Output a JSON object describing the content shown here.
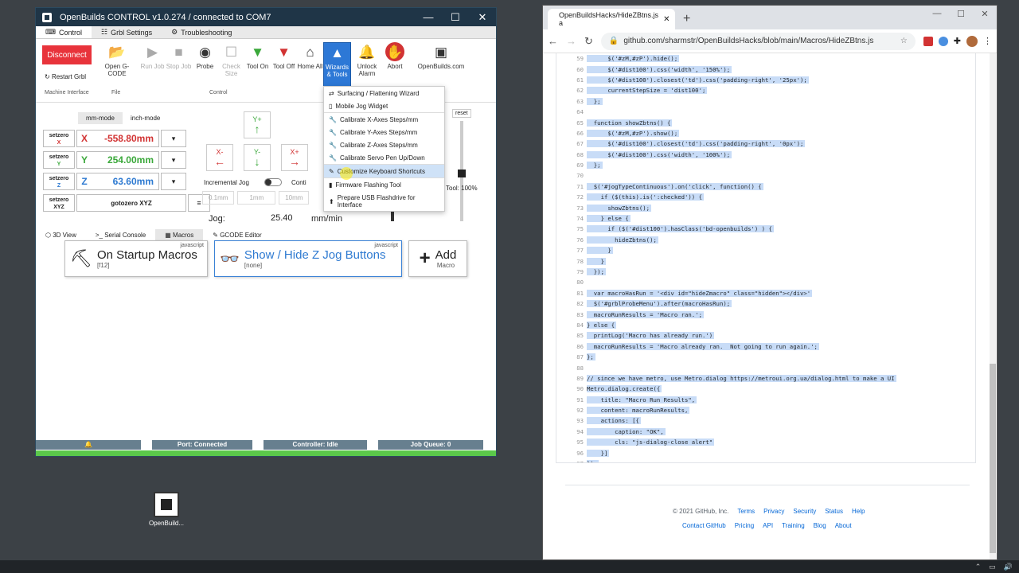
{
  "openbuilds": {
    "title": "OpenBuilds CONTROL v1.0.274 / connected to COM7",
    "window_controls": [
      "—",
      "☐",
      "✕"
    ],
    "tabs": [
      "Control",
      "Grbl Settings",
      "Troubleshooting"
    ],
    "ribbon": {
      "disconnect": "Disconnect",
      "restart": "Restart Grbl",
      "open_label": "Open G-CODE",
      "run": "Run Job",
      "stop": "Stop Job",
      "probe": "Probe",
      "check_size": "Check Size",
      "tool_on": "Tool On",
      "tool_off": "Tool Off",
      "home_all": "Home All",
      "wizards": "Wizards & Tools",
      "unlock": "Unlock Alarm",
      "abort": "Abort",
      "openbuilds_com": "OpenBuilds.com",
      "group_machine": "Machine Interface",
      "group_file": "File",
      "group_control": "Control"
    },
    "wizard_menu": [
      "Surfacing / Flattening Wizard",
      "Mobile Jog Widget",
      "Calibrate X-Axes Steps/mm",
      "Calibrate Y-Axes Steps/mm",
      "Calibrate Z-Axes Steps/mm",
      "Calibrate Servo Pen Up/Down",
      "Customize Keyboard Shortcuts",
      "Firmware Flashing Tool",
      "Prepare USB Flashdrive for Interface"
    ],
    "modes": [
      "mm-mode",
      "inch-mode"
    ],
    "dro": [
      {
        "zero": "setzero",
        "axis": "X",
        "value": "-558.80mm",
        "color": "#d23333"
      },
      {
        "zero": "setzero",
        "axis": "Y",
        "value": "254.00mm",
        "color": "#3aa83a"
      },
      {
        "zero": "setzero",
        "axis": "Z",
        "value": "63.60mm",
        "color": "#2e7ad1"
      }
    ],
    "setzero_xyz": "setzero XYZ",
    "gotozero_xyz": "gotozero XYZ",
    "jog": {
      "y_plus": "Y+",
      "y_minus": "Y-",
      "x_minus": "X-",
      "x_plus": "X+",
      "incremental": "Incremental Jog",
      "continuous": "Conti",
      "steps": [
        "0.1mm",
        "1mm",
        "10mm"
      ],
      "feed_label": "Jog:",
      "feed_value": "25.40",
      "feed_unit": "mm/min",
      "reset": "reset",
      "tool_pct": "Tool: 100%"
    },
    "lower_tabs": [
      "3D View",
      "Serial Console",
      "Macros",
      "GCODE Editor"
    ],
    "macros": [
      {
        "title": "On Startup Macros",
        "lang": "javascript",
        "key": "[f12]"
      },
      {
        "title": "Show / Hide Z Jog Buttons",
        "lang": "javascript",
        "key": "[none]"
      }
    ],
    "add_macro": "Add",
    "add_macro_sub": "Macro",
    "status": {
      "port": "Port: Connected",
      "controller": "Controller: Idle",
      "queue": "Job Queue: 0"
    }
  },
  "desktop_icon": "OpenBuild...",
  "chrome": {
    "tab_title": "OpenBuildsHacks/HideZBtns.js a",
    "url": "github.com/sharmstr/OpenBuildsHacks/blob/main/Macros/HideZBtns.js",
    "code": [
      {
        "n": "59",
        "t": "      $('#zM,#zP').hide();"
      },
      {
        "n": "60",
        "t": "      $('#dist100').css('width', '150%');"
      },
      {
        "n": "61",
        "t": "      $('#dist100').closest('td').css('padding-right', '25px');"
      },
      {
        "n": "62",
        "t": "      currentStepSize = 'dist100';"
      },
      {
        "n": "63",
        "t": "  };"
      },
      {
        "n": "64",
        "t": ""
      },
      {
        "n": "65",
        "t": "  function showZbtns() {"
      },
      {
        "n": "66",
        "t": "      $('#zM,#zP').show();"
      },
      {
        "n": "67",
        "t": "      $('#dist100').closest('td').css('padding-right', '0px');"
      },
      {
        "n": "68",
        "t": "      $('#dist100').css('width', '100%');"
      },
      {
        "n": "69",
        "t": "  };"
      },
      {
        "n": "70",
        "t": ""
      },
      {
        "n": "71",
        "t": "  $('#jogTypeContinuous').on('click', function() {"
      },
      {
        "n": "72",
        "t": "    if ($(this).is(':checked')) {"
      },
      {
        "n": "73",
        "t": "      showZbtns();"
      },
      {
        "n": "74",
        "t": "    } else {"
      },
      {
        "n": "75",
        "t": "      if ($('#dist100').hasClass('bd-openbuilds') ) {"
      },
      {
        "n": "76",
        "t": "        hideZbtns();"
      },
      {
        "n": "77",
        "t": "      }"
      },
      {
        "n": "78",
        "t": "    }"
      },
      {
        "n": "79",
        "t": "  });"
      },
      {
        "n": "80",
        "t": ""
      },
      {
        "n": "81",
        "t": "  var macroHasRun = '<div id=\"hideZmacro\" class=\"hidden\"></div>'"
      },
      {
        "n": "82",
        "t": "  $('#grblProbeMenu').after(macroHasRun);"
      },
      {
        "n": "83",
        "t": "  macroRunResults = 'Macro ran.';"
      },
      {
        "n": "84",
        "t": "} else {"
      },
      {
        "n": "85",
        "t": "  printLog('Macro has already run.')"
      },
      {
        "n": "86",
        "t": "  macroRunResults = 'Macro already ran.  Not going to run again.';"
      },
      {
        "n": "87",
        "t": "};"
      },
      {
        "n": "88",
        "t": ""
      },
      {
        "n": "89",
        "t": "// since we have metro, use Metro.dialog https://metroui.org.ua/dialog.html to make a UI"
      },
      {
        "n": "90",
        "t": "Metro.dialog.create({"
      },
      {
        "n": "91",
        "t": "    title: \"Macro Run Results\","
      },
      {
        "n": "92",
        "t": "    content: macroRunResults,"
      },
      {
        "n": "93",
        "t": "    actions: [{"
      },
      {
        "n": "94",
        "t": "        caption: \"OK\","
      },
      {
        "n": "95",
        "t": "        cls: \"js-dialog-close alert\""
      },
      {
        "n": "96",
        "t": "    }]"
      },
      {
        "n": "97",
        "t": "});"
      }
    ],
    "footer_row1": [
      "© 2021 GitHub, Inc.",
      "Terms",
      "Privacy",
      "Security",
      "Status",
      "Help"
    ],
    "footer_row2": [
      "Contact GitHub",
      "Pricing",
      "API",
      "Training",
      "Blog",
      "About"
    ]
  }
}
